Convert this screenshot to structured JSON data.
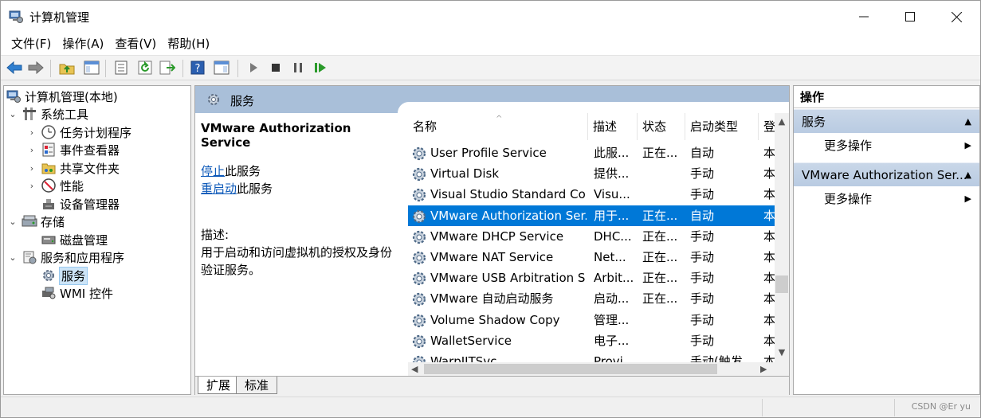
{
  "window": {
    "title": "计算机管理"
  },
  "menu": [
    "文件(F)",
    "操作(A)",
    "查看(V)",
    "帮助(H)"
  ],
  "toolbar_icons": [
    "back-arrow-icon",
    "forward-arrow-icon",
    "folder-up-icon",
    "show-hide-tree-icon",
    "properties-icon",
    "refresh-icon",
    "export-list-icon",
    "help-icon",
    "show-hide-action-pane-icon",
    "start-service-icon",
    "stop-service-icon",
    "pause-service-icon",
    "restart-service-icon"
  ],
  "tree": {
    "root": "计算机管理(本地)",
    "system_tools": "系统工具",
    "task_scheduler": "任务计划程序",
    "event_viewer": "事件查看器",
    "shared_folders": "共享文件夹",
    "performance": "性能",
    "device_manager": "设备管理器",
    "storage": "存储",
    "disk_management": "磁盘管理",
    "services_apps": "服务和应用程序",
    "services": "服务",
    "wmi": "WMI 控件"
  },
  "center": {
    "header_title": "服务",
    "selected_service": "VMware Authorization Service",
    "stop_link": "停止",
    "stop_suffix": "此服务",
    "restart_link": "重启动",
    "restart_suffix": "此服务",
    "desc_label": "描述:",
    "desc_text": "用于启动和访问虚拟机的授权及身份验证服务。"
  },
  "list": {
    "columns": [
      "名称",
      "描述",
      "状态",
      "启动类型",
      "登"
    ],
    "rows": [
      {
        "name": "User Profile Service",
        "desc": "此服...",
        "status": "正在...",
        "startup": "自动",
        "logon": "本"
      },
      {
        "name": "Virtual Disk",
        "desc": "提供...",
        "status": "",
        "startup": "手动",
        "logon": "本"
      },
      {
        "name": "Visual Studio Standard Coll...",
        "desc": "Visu...",
        "status": "",
        "startup": "手动",
        "logon": "本"
      },
      {
        "name": "VMware Authorization Ser...",
        "desc": "用于...",
        "status": "正在...",
        "startup": "自动",
        "logon": "本"
      },
      {
        "name": "VMware DHCP Service",
        "desc": "DHC...",
        "status": "正在...",
        "startup": "手动",
        "logon": "本"
      },
      {
        "name": "VMware NAT Service",
        "desc": "Net...",
        "status": "正在...",
        "startup": "手动",
        "logon": "本"
      },
      {
        "name": "VMware USB Arbitration S...",
        "desc": "Arbit...",
        "status": "正在...",
        "startup": "手动",
        "logon": "本"
      },
      {
        "name": "VMware 自动启动服务",
        "desc": "启动...",
        "status": "正在...",
        "startup": "手动",
        "logon": "本"
      },
      {
        "name": "Volume Shadow Copy",
        "desc": "管理...",
        "status": "",
        "startup": "手动",
        "logon": "本"
      },
      {
        "name": "WalletService",
        "desc": "电子...",
        "status": "",
        "startup": "手动",
        "logon": "本"
      },
      {
        "name": "WarpJITSvc",
        "desc": "Provi...",
        "status": "",
        "startup": "手动(触发...",
        "logon": "本"
      }
    ],
    "selected_index": 3
  },
  "tabs": [
    "扩展",
    "标准"
  ],
  "actions": {
    "header": "操作",
    "section1": "服务",
    "more1": "更多操作",
    "section2": "VMware Authorization Ser...",
    "more2": "更多操作"
  },
  "status": {
    "watermark": "CSDN @Er yu"
  },
  "colors": {
    "selection": "#0078d7",
    "header_band": "#a9bfd9",
    "link": "#0a57b8"
  }
}
